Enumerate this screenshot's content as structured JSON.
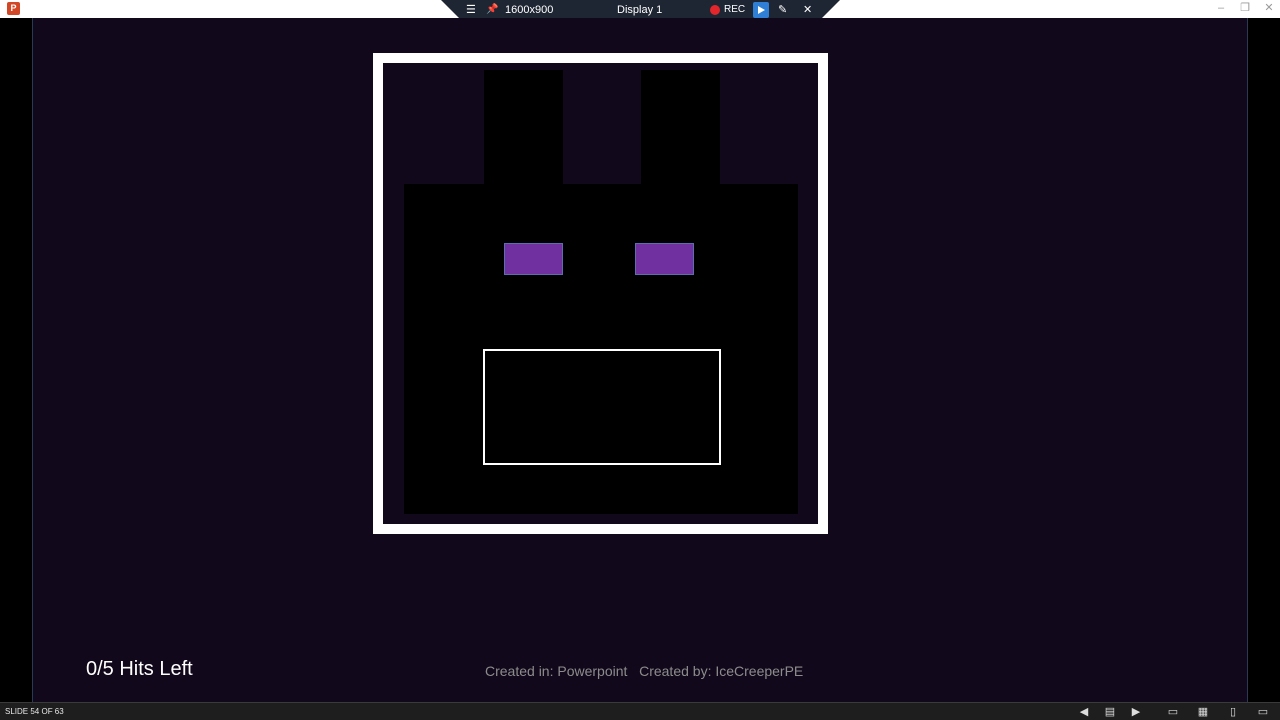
{
  "window": {
    "app_icon_letter": "P",
    "minimize_glyph": "–",
    "restore_glyph": "❐",
    "close_glyph": "✕"
  },
  "recorder": {
    "menu_glyph": "☰",
    "pin_glyph": "📌",
    "resolution": "1600x900",
    "display": "Display 1",
    "rec_label": "REC",
    "pen_glyph": "✎",
    "close_glyph": "✕"
  },
  "slide": {
    "hits_text": "0/5 Hits Left",
    "credits_text": "Created in: Powerpoint   Created by: IceCreeperPE",
    "colors": {
      "background": "#12081b",
      "frame": "#ffffff",
      "face": "#000000",
      "eyes": "#7030a0"
    }
  },
  "statusbar": {
    "slide_counter": "SLIDE 54 OF 63",
    "icons": [
      "prev-icon",
      "notes-icon",
      "next-icon",
      "normal-view-icon",
      "slide-sorter-icon",
      "reading-view-icon",
      "display-settings-icon"
    ]
  }
}
